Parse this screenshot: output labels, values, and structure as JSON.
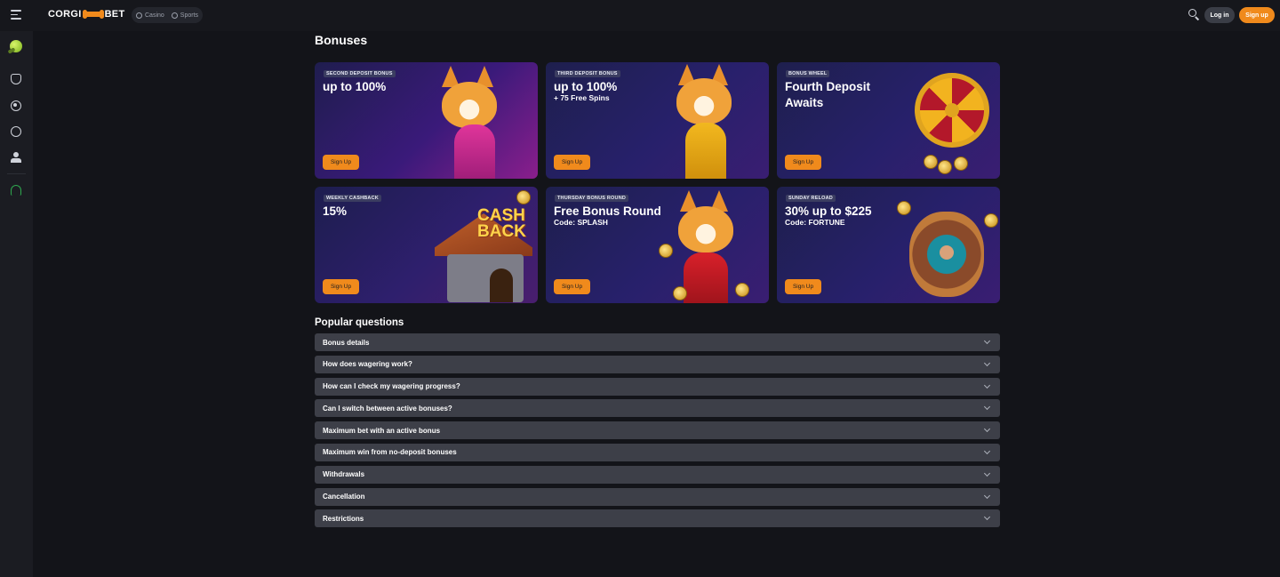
{
  "header": {
    "logo_left": "CORGI",
    "logo_right": "BET",
    "modes": [
      "Casino",
      "Sports"
    ],
    "login_label": "Log in",
    "signup_label": "Sign up"
  },
  "colors": {
    "accent": "#f08a1c",
    "background": "#131419",
    "sidebar": "#1b1c22",
    "faq_row": "#3d3f48"
  },
  "sidebar": {
    "icons": [
      "tennis-ball-icon",
      "shield-icon",
      "target-icon",
      "sports-ball-icon",
      "person-icon",
      "headset-icon"
    ]
  },
  "page": {
    "title": "Bonuses"
  },
  "cards": [
    {
      "tag": "SECOND DEPOSIT BONUS",
      "headline": "up to 100%",
      "sub": "",
      "cta": "Sign Up"
    },
    {
      "tag": "THIRD DEPOSIT BONUS",
      "headline": "up to 100%",
      "sub": "+ 75 Free Spins",
      "cta": "Sign Up"
    },
    {
      "tag": "BONUS WHEEL",
      "headline": "Fourth Deposit Awaits",
      "sub": "",
      "cta": "Sign Up"
    },
    {
      "tag": "WEEKLY CASHBACK",
      "headline": "15%",
      "sub": "",
      "cta": "Sign Up"
    },
    {
      "tag": "THURSDAY BONUS ROUND",
      "headline": "Free Bonus Round",
      "sub": "Code: SPLASH",
      "cta": "Sign Up"
    },
    {
      "tag": "SUNDAY RELOAD",
      "headline": "30% up to $225",
      "sub": "Code: FORTUNE",
      "cta": "Sign Up"
    }
  ],
  "cashback_sign": [
    "CASH",
    "BACK"
  ],
  "faq": {
    "title": "Popular questions",
    "items": [
      "Bonus details",
      "How does wagering work?",
      "How can I check my wagering progress?",
      "Can I switch between active bonuses?",
      "Maximum bet with an active bonus",
      "Maximum win from no-deposit bonuses",
      "Withdrawals",
      "Cancellation",
      "Restrictions"
    ]
  }
}
